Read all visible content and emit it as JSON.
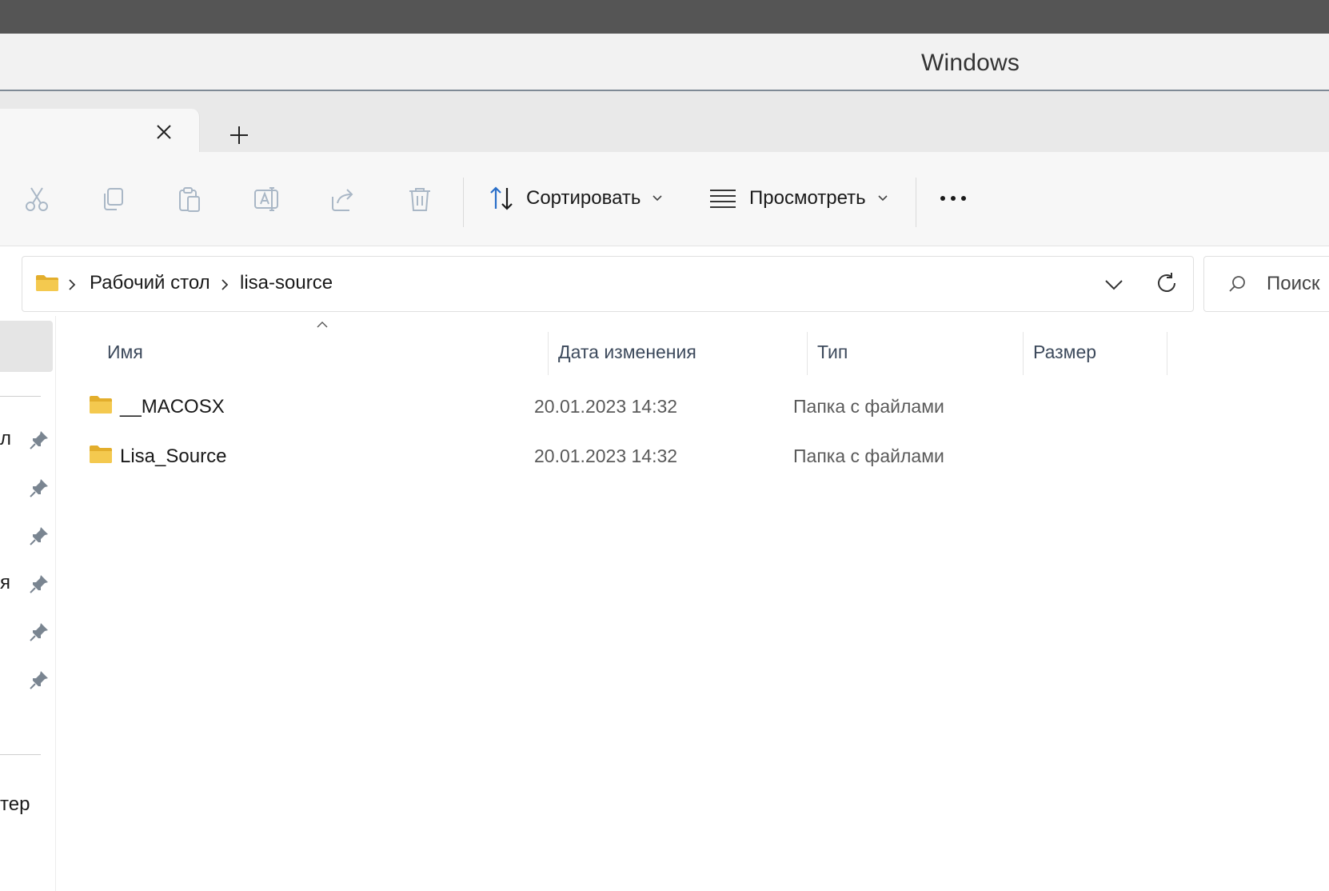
{
  "window": {
    "title": "Windows"
  },
  "toolbar": {
    "sort_label": "Сортировать",
    "view_label": "Просмотреть",
    "icons": [
      "cut-icon",
      "copy-icon",
      "paste-icon",
      "rename-icon",
      "share-icon",
      "delete-icon"
    ]
  },
  "address": {
    "crumbs": [
      "Рабочий стол",
      "lisa-source"
    ]
  },
  "search": {
    "placeholder": "Поиск"
  },
  "sidebar": {
    "fragments": [
      "л",
      "",
      "",
      "я",
      "",
      ""
    ],
    "bottom_fragment": "тер"
  },
  "columns": {
    "name": "Имя",
    "date": "Дата изменения",
    "type": "Тип",
    "size": "Размер"
  },
  "files": [
    {
      "name": "__MACOSX",
      "date": "20.01.2023 14:32",
      "type": "Папка с файлами",
      "size": ""
    },
    {
      "name": "Lisa_Source",
      "date": "20.01.2023 14:32",
      "type": "Папка с файлами",
      "size": ""
    }
  ],
  "colors": {
    "folder": "#f4c94f",
    "folder_dark": "#e3ae2c",
    "accent": "#2a6fc9",
    "disabled_icon": "#a9b7c6"
  }
}
